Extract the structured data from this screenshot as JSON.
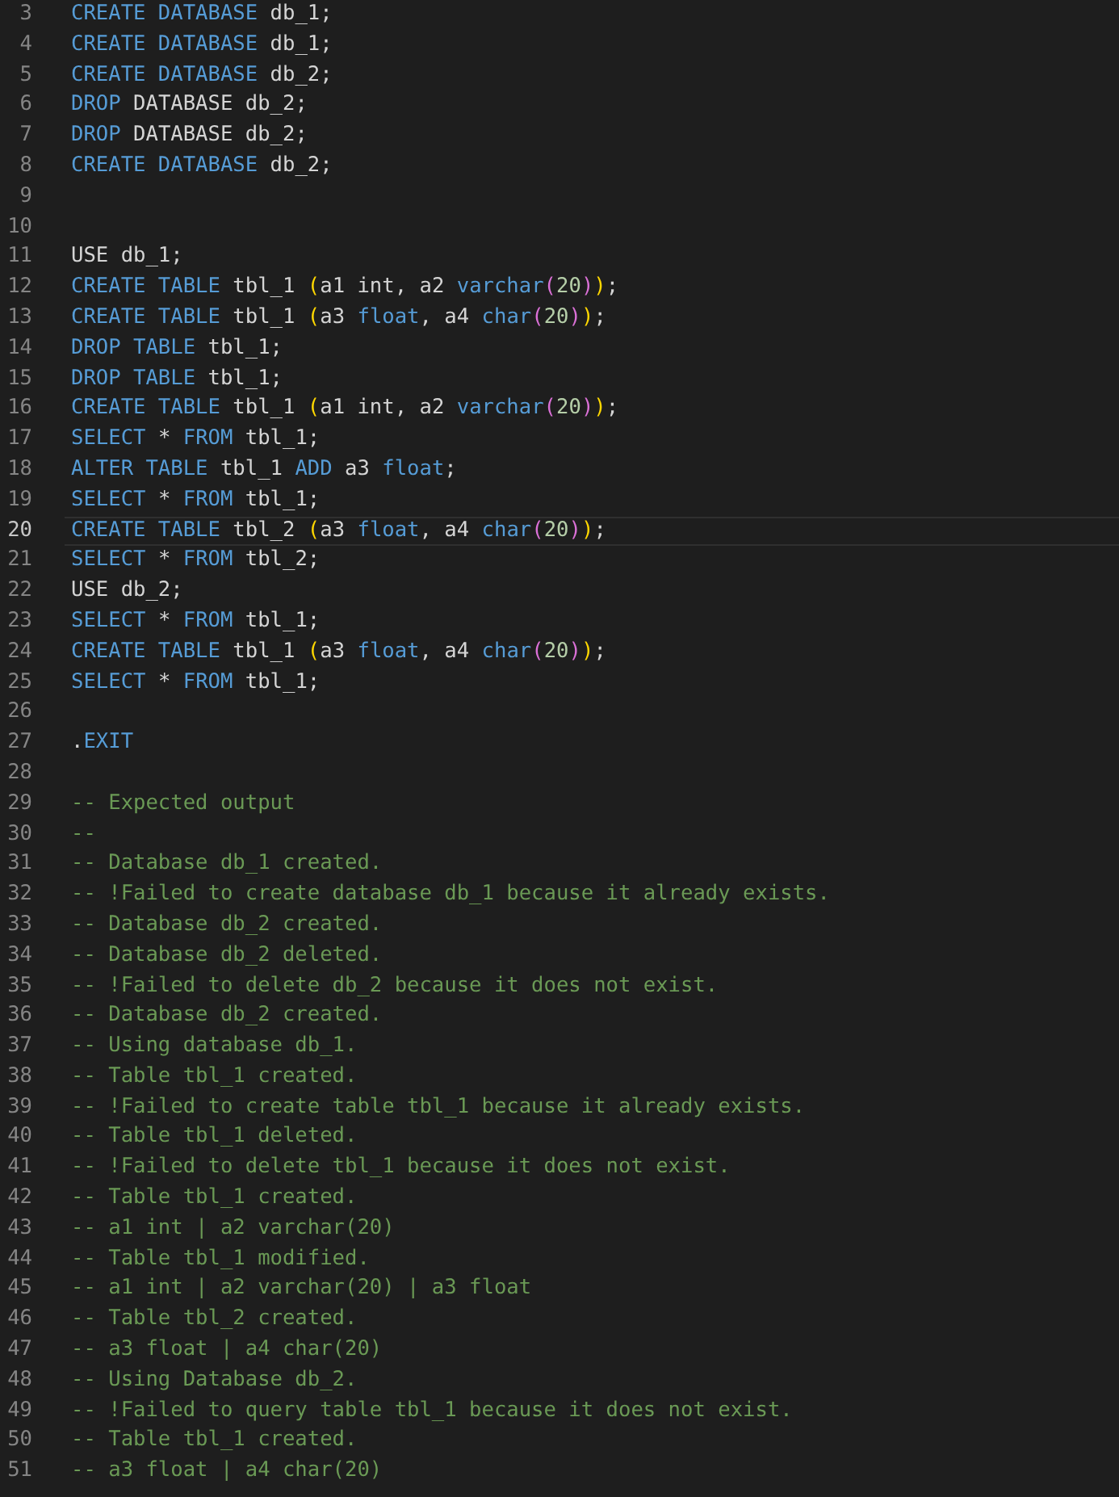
{
  "editor": {
    "lines": [
      {
        "number": "3",
        "current": false,
        "tokens": [
          {
            "kind": "keyword",
            "text": "CREATE DATABASE"
          },
          {
            "kind": "ident",
            "text": " db_1;"
          }
        ]
      },
      {
        "number": "4",
        "current": false,
        "tokens": [
          {
            "kind": "keyword",
            "text": "CREATE DATABASE"
          },
          {
            "kind": "ident",
            "text": " db_1;"
          }
        ]
      },
      {
        "number": "5",
        "current": false,
        "tokens": [
          {
            "kind": "keyword",
            "text": "CREATE DATABASE"
          },
          {
            "kind": "ident",
            "text": " db_2;"
          }
        ]
      },
      {
        "number": "6",
        "current": false,
        "tokens": [
          {
            "kind": "keyword",
            "text": "DROP"
          },
          {
            "kind": "ident",
            "text": " DATABASE db_2;"
          }
        ]
      },
      {
        "number": "7",
        "current": false,
        "tokens": [
          {
            "kind": "keyword",
            "text": "DROP"
          },
          {
            "kind": "ident",
            "text": " DATABASE db_2;"
          }
        ]
      },
      {
        "number": "8",
        "current": false,
        "tokens": [
          {
            "kind": "keyword",
            "text": "CREATE DATABASE"
          },
          {
            "kind": "ident",
            "text": " db_2;"
          }
        ]
      },
      {
        "number": "9",
        "current": false
      },
      {
        "number": "10",
        "current": false
      },
      {
        "number": "11",
        "current": false,
        "tokens": [
          {
            "kind": "ident",
            "text": "USE db_1;"
          }
        ]
      },
      {
        "number": "12",
        "current": false,
        "tokens": [
          {
            "kind": "keyword",
            "text": "CREATE TABLE"
          },
          {
            "kind": "ident",
            "text": " tbl_1 "
          },
          {
            "kind": "bracket_outer",
            "text": "("
          },
          {
            "kind": "ident",
            "text": "a1 int, a2 "
          },
          {
            "kind": "type",
            "text": "varchar"
          },
          {
            "kind": "bracket_inner",
            "text": "("
          },
          {
            "kind": "number",
            "text": "20"
          },
          {
            "kind": "bracket_inner",
            "text": ")"
          },
          {
            "kind": "bracket_outer",
            "text": ")"
          },
          {
            "kind": "ident",
            "text": ";"
          }
        ]
      },
      {
        "number": "13",
        "current": false,
        "tokens": [
          {
            "kind": "keyword",
            "text": "CREATE TABLE"
          },
          {
            "kind": "ident",
            "text": " tbl_1 "
          },
          {
            "kind": "bracket_outer",
            "text": "("
          },
          {
            "kind": "ident",
            "text": "a3 "
          },
          {
            "kind": "type",
            "text": "float"
          },
          {
            "kind": "ident",
            "text": ", a4 "
          },
          {
            "kind": "type",
            "text": "char"
          },
          {
            "kind": "bracket_inner",
            "text": "("
          },
          {
            "kind": "number",
            "text": "20"
          },
          {
            "kind": "bracket_inner",
            "text": ")"
          },
          {
            "kind": "bracket_outer",
            "text": ")"
          },
          {
            "kind": "ident",
            "text": ";"
          }
        ]
      },
      {
        "number": "14",
        "current": false,
        "tokens": [
          {
            "kind": "keyword",
            "text": "DROP TABLE"
          },
          {
            "kind": "ident",
            "text": " tbl_1;"
          }
        ]
      },
      {
        "number": "15",
        "current": false,
        "tokens": [
          {
            "kind": "keyword",
            "text": "DROP TABLE"
          },
          {
            "kind": "ident",
            "text": " tbl_1;"
          }
        ]
      },
      {
        "number": "16",
        "current": false,
        "tokens": [
          {
            "kind": "keyword",
            "text": "CREATE TABLE"
          },
          {
            "kind": "ident",
            "text": " tbl_1 "
          },
          {
            "kind": "bracket_outer",
            "text": "("
          },
          {
            "kind": "ident",
            "text": "a1 int, a2 "
          },
          {
            "kind": "type",
            "text": "varchar"
          },
          {
            "kind": "bracket_inner",
            "text": "("
          },
          {
            "kind": "number",
            "text": "20"
          },
          {
            "kind": "bracket_inner",
            "text": ")"
          },
          {
            "kind": "bracket_outer",
            "text": ")"
          },
          {
            "kind": "ident",
            "text": ";"
          }
        ]
      },
      {
        "number": "17",
        "current": false,
        "tokens": [
          {
            "kind": "keyword",
            "text": "SELECT"
          },
          {
            "kind": "ident",
            "text": " * "
          },
          {
            "kind": "keyword",
            "text": "FROM"
          },
          {
            "kind": "ident",
            "text": " tbl_1;"
          }
        ]
      },
      {
        "number": "18",
        "current": false,
        "tokens": [
          {
            "kind": "keyword",
            "text": "ALTER TABLE"
          },
          {
            "kind": "ident",
            "text": " tbl_1 "
          },
          {
            "kind": "keyword",
            "text": "ADD"
          },
          {
            "kind": "ident",
            "text": " a3 "
          },
          {
            "kind": "type",
            "text": "float"
          },
          {
            "kind": "ident",
            "text": ";"
          }
        ]
      },
      {
        "number": "19",
        "current": false,
        "tokens": [
          {
            "kind": "keyword",
            "text": "SELECT"
          },
          {
            "kind": "ident",
            "text": " * "
          },
          {
            "kind": "keyword",
            "text": "FROM"
          },
          {
            "kind": "ident",
            "text": " tbl_1;"
          }
        ]
      },
      {
        "number": "20",
        "current": true,
        "tokens": [
          {
            "kind": "keyword",
            "text": "CREATE TABLE"
          },
          {
            "kind": "ident",
            "text": " tbl_2 "
          },
          {
            "kind": "bracket_outer",
            "text": "("
          },
          {
            "kind": "ident",
            "text": "a3 "
          },
          {
            "kind": "type",
            "text": "float"
          },
          {
            "kind": "ident",
            "text": ", a4 "
          },
          {
            "kind": "type",
            "text": "char"
          },
          {
            "kind": "bracket_inner",
            "text": "("
          },
          {
            "kind": "number",
            "text": "20"
          },
          {
            "kind": "bracket_inner",
            "text": ")"
          },
          {
            "kind": "bracket_outer",
            "text": ")"
          },
          {
            "kind": "ident",
            "text": ";"
          }
        ]
      },
      {
        "number": "21",
        "current": false,
        "tokens": [
          {
            "kind": "keyword",
            "text": "SELECT"
          },
          {
            "kind": "ident",
            "text": " * "
          },
          {
            "kind": "keyword",
            "text": "FROM"
          },
          {
            "kind": "ident",
            "text": " tbl_2;"
          }
        ]
      },
      {
        "number": "22",
        "current": false,
        "tokens": [
          {
            "kind": "ident",
            "text": "USE db_2;"
          }
        ]
      },
      {
        "number": "23",
        "current": false,
        "tokens": [
          {
            "kind": "keyword",
            "text": "SELECT"
          },
          {
            "kind": "ident",
            "text": " * "
          },
          {
            "kind": "keyword",
            "text": "FROM"
          },
          {
            "kind": "ident",
            "text": " tbl_1;"
          }
        ]
      },
      {
        "number": "24",
        "current": false,
        "tokens": [
          {
            "kind": "keyword",
            "text": "CREATE TABLE"
          },
          {
            "kind": "ident",
            "text": " tbl_1 "
          },
          {
            "kind": "bracket_outer",
            "text": "("
          },
          {
            "kind": "ident",
            "text": "a3 "
          },
          {
            "kind": "type",
            "text": "float"
          },
          {
            "kind": "ident",
            "text": ", a4 "
          },
          {
            "kind": "type",
            "text": "char"
          },
          {
            "kind": "bracket_inner",
            "text": "("
          },
          {
            "kind": "number",
            "text": "20"
          },
          {
            "kind": "bracket_inner",
            "text": ")"
          },
          {
            "kind": "bracket_outer",
            "text": ")"
          },
          {
            "kind": "ident",
            "text": ";"
          }
        ]
      },
      {
        "number": "25",
        "current": false,
        "tokens": [
          {
            "kind": "keyword",
            "text": "SELECT"
          },
          {
            "kind": "ident",
            "text": " * "
          },
          {
            "kind": "keyword",
            "text": "FROM"
          },
          {
            "kind": "ident",
            "text": " tbl_1;"
          }
        ]
      },
      {
        "number": "26",
        "current": false
      },
      {
        "number": "27",
        "current": false,
        "tokens": [
          {
            "kind": "ident",
            "text": "."
          },
          {
            "kind": "keyword",
            "text": "EXIT"
          }
        ]
      },
      {
        "number": "28",
        "current": false
      },
      {
        "number": "29",
        "current": false,
        "tokens": [
          {
            "kind": "comment",
            "text": "-- Expected output"
          }
        ]
      },
      {
        "number": "30",
        "current": false,
        "tokens": [
          {
            "kind": "comment",
            "text": "--"
          }
        ]
      },
      {
        "number": "31",
        "current": false,
        "tokens": [
          {
            "kind": "comment",
            "text": "-- Database db_1 created."
          }
        ]
      },
      {
        "number": "32",
        "current": false,
        "tokens": [
          {
            "kind": "comment",
            "text": "-- !Failed to create database db_1 because it already exists."
          }
        ]
      },
      {
        "number": "33",
        "current": false,
        "tokens": [
          {
            "kind": "comment",
            "text": "-- Database db_2 created."
          }
        ]
      },
      {
        "number": "34",
        "current": false,
        "tokens": [
          {
            "kind": "comment",
            "text": "-- Database db_2 deleted."
          }
        ]
      },
      {
        "number": "35",
        "current": false,
        "tokens": [
          {
            "kind": "comment",
            "text": "-- !Failed to delete db_2 because it does not exist."
          }
        ]
      },
      {
        "number": "36",
        "current": false,
        "tokens": [
          {
            "kind": "comment",
            "text": "-- Database db_2 created."
          }
        ]
      },
      {
        "number": "37",
        "current": false,
        "tokens": [
          {
            "kind": "comment",
            "text": "-- Using database db_1."
          }
        ]
      },
      {
        "number": "38",
        "current": false,
        "tokens": [
          {
            "kind": "comment",
            "text": "-- Table tbl_1 created."
          }
        ]
      },
      {
        "number": "39",
        "current": false,
        "tokens": [
          {
            "kind": "comment",
            "text": "-- !Failed to create table tbl_1 because it already exists."
          }
        ]
      },
      {
        "number": "40",
        "current": false,
        "tokens": [
          {
            "kind": "comment",
            "text": "-- Table tbl_1 deleted."
          }
        ]
      },
      {
        "number": "41",
        "current": false,
        "tokens": [
          {
            "kind": "comment",
            "text": "-- !Failed to delete tbl_1 because it does not exist."
          }
        ]
      },
      {
        "number": "42",
        "current": false,
        "tokens": [
          {
            "kind": "comment",
            "text": "-- Table tbl_1 created."
          }
        ]
      },
      {
        "number": "43",
        "current": false,
        "tokens": [
          {
            "kind": "comment",
            "text": "-- a1 int | a2 varchar(20)"
          }
        ]
      },
      {
        "number": "44",
        "current": false,
        "tokens": [
          {
            "kind": "comment",
            "text": "-- Table tbl_1 modified."
          }
        ]
      },
      {
        "number": "45",
        "current": false,
        "tokens": [
          {
            "kind": "comment",
            "text": "-- a1 int | a2 varchar(20) | a3 float"
          }
        ]
      },
      {
        "number": "46",
        "current": false,
        "tokens": [
          {
            "kind": "comment",
            "text": "-- Table tbl_2 created."
          }
        ]
      },
      {
        "number": "47",
        "current": false,
        "tokens": [
          {
            "kind": "comment",
            "text": "-- a3 float | a4 char(20)"
          }
        ]
      },
      {
        "number": "48",
        "current": false,
        "tokens": [
          {
            "kind": "comment",
            "text": "-- Using Database db_2."
          }
        ]
      },
      {
        "number": "49",
        "current": false,
        "tokens": [
          {
            "kind": "comment",
            "text": "-- !Failed to query table tbl_1 because it does not exist."
          }
        ]
      },
      {
        "number": "50",
        "current": false,
        "tokens": [
          {
            "kind": "comment",
            "text": "-- Table tbl_1 created."
          }
        ]
      },
      {
        "number": "51",
        "current": false,
        "tokens": [
          {
            "kind": "comment",
            "text": "-- a3 float | a4 char(20)"
          }
        ]
      }
    ]
  }
}
